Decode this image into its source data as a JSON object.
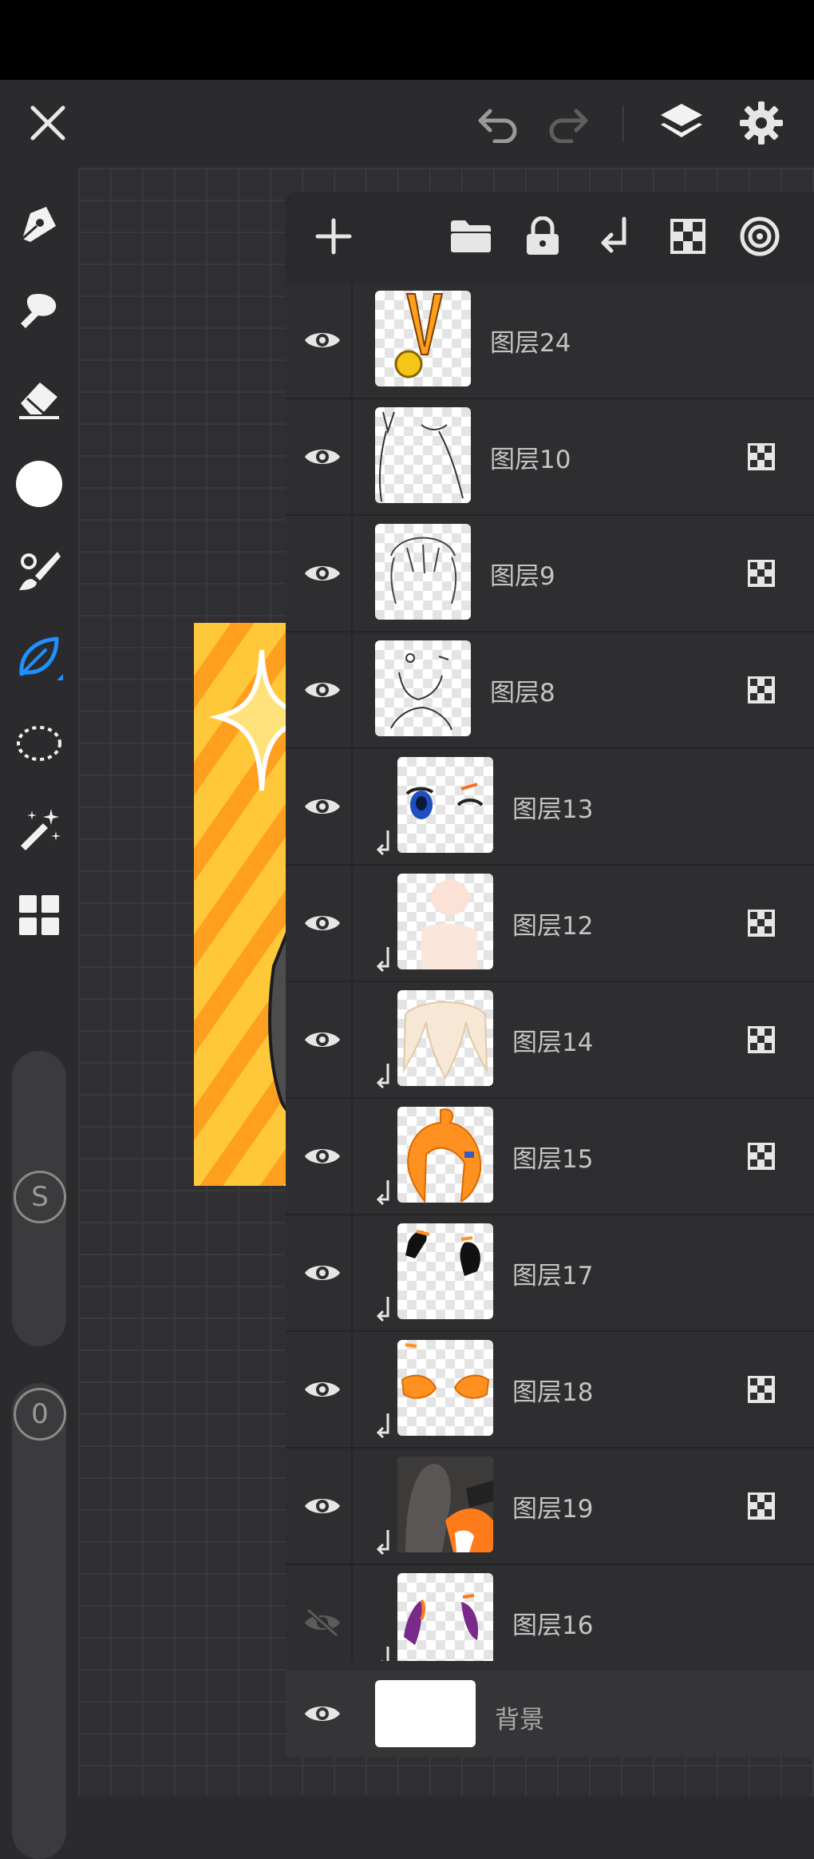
{
  "top_bar": {
    "icons": [
      "close-icon",
      "undo-icon",
      "redo-icon",
      "layers-icon",
      "settings-icon"
    ]
  },
  "left_toolbar": {
    "tools": [
      "pen-icon",
      "smudge-icon",
      "eraser-icon",
      "color-icon",
      "brush-icon",
      "leaf-tool-icon",
      "lasso-icon",
      "magic-wand-icon",
      "grid-menu-icon"
    ],
    "active_tool": "leaf-tool-icon",
    "active_color": "#1e90ff",
    "size_slider_label": "S",
    "opacity_slider_label": "0"
  },
  "layers_panel": {
    "toolbar_icons": [
      "add-layer-icon",
      "folder-icon",
      "lock-icon",
      "clip-icon",
      "alpha-icon",
      "blend-mode-icon"
    ],
    "layers": [
      {
        "name": "图层24",
        "visible": true,
        "alpha_lock": false,
        "clipped": false
      },
      {
        "name": "图层10",
        "visible": true,
        "alpha_lock": true,
        "clipped": false
      },
      {
        "name": "图层9",
        "visible": true,
        "alpha_lock": true,
        "clipped": false
      },
      {
        "name": "图层8",
        "visible": true,
        "alpha_lock": true,
        "clipped": false
      },
      {
        "name": "图层13",
        "visible": true,
        "alpha_lock": false,
        "clipped": true
      },
      {
        "name": "图层12",
        "visible": true,
        "alpha_lock": true,
        "clipped": true
      },
      {
        "name": "图层14",
        "visible": true,
        "alpha_lock": true,
        "clipped": true
      },
      {
        "name": "图层15",
        "visible": true,
        "alpha_lock": true,
        "clipped": true
      },
      {
        "name": "图层17",
        "visible": true,
        "alpha_lock": false,
        "clipped": true
      },
      {
        "name": "图层18",
        "visible": true,
        "alpha_lock": true,
        "clipped": true
      },
      {
        "name": "图层19",
        "visible": true,
        "alpha_lock": true,
        "clipped": true
      },
      {
        "name": "图层16",
        "visible": false,
        "alpha_lock": false,
        "clipped": true
      }
    ],
    "background_layer": {
      "name": "背景",
      "visible": true
    }
  },
  "colors": {
    "panel_bg": "#2e2e31",
    "accent_blue": "#1e90ff",
    "art_orange": "#ff9f1f",
    "art_yellow": "#ffc83a"
  }
}
